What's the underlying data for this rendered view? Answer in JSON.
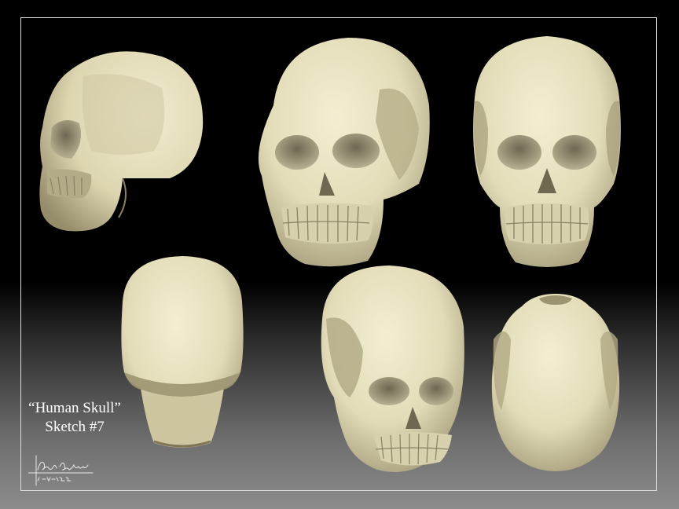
{
  "artwork": {
    "title_line": "“Human Skull”",
    "subtitle_line": "Sketch #7",
    "signature_name": "Richard Lamar",
    "signature_date": "5-31-2012"
  },
  "views": [
    "side-profile-view",
    "three-quarter-front-view",
    "front-view",
    "back-view",
    "three-quarter-low-view",
    "top-view"
  ],
  "colors": {
    "bone": "#e2dcb8",
    "bone_shadow": "#7d7457",
    "background_top": "#000000",
    "background_bottom": "#8c8c8c",
    "frame": "#dcdcdc"
  }
}
